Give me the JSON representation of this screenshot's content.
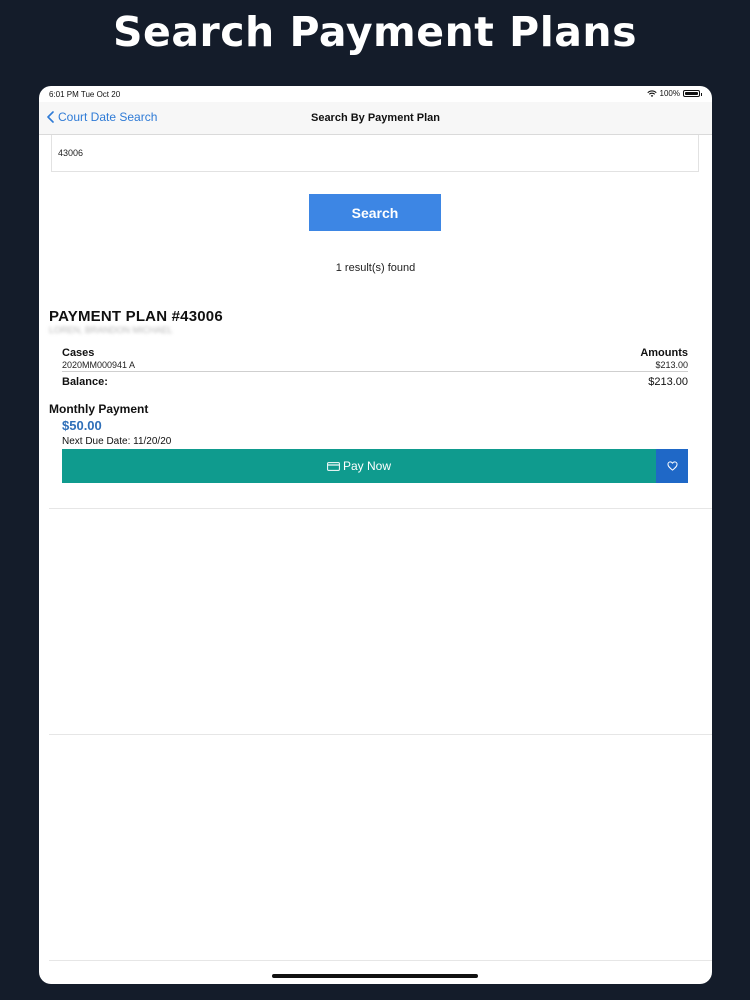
{
  "hero": {
    "title": "Search Payment Plans"
  },
  "status_bar": {
    "time": "6:01 PM   Tue Oct 20",
    "battery": "100%"
  },
  "nav": {
    "back_label": "Court Date Search",
    "title": "Search By Payment Plan"
  },
  "search": {
    "value": "43006",
    "button_label": "Search",
    "results_text": "1 result(s) found"
  },
  "plan": {
    "title": "PAYMENT PLAN #43006",
    "owner_redacted": "LOREN, BRANDON MICHAEL",
    "cases_header": "Cases",
    "amounts_header": "Amounts",
    "cases": [
      {
        "number": "2020MM000941 A",
        "amount": "$213.00"
      }
    ],
    "balance_label": "Balance:",
    "balance_value": "$213.00",
    "monthly_label": "Monthly Payment",
    "monthly_amount": "$50.00",
    "next_due": "Next Due Date: 11/20/20",
    "pay_button_label": "Pay Now"
  },
  "colors": {
    "background": "#141c2a",
    "accent": "#3d86e4",
    "pay_button": "#0f9b8e",
    "favorite_button": "#1f68c7",
    "link": "#2f7bd6"
  },
  "icons": [
    "back-chevron-icon",
    "wifi-icon",
    "battery-icon",
    "credit-card-icon",
    "heart-icon"
  ]
}
